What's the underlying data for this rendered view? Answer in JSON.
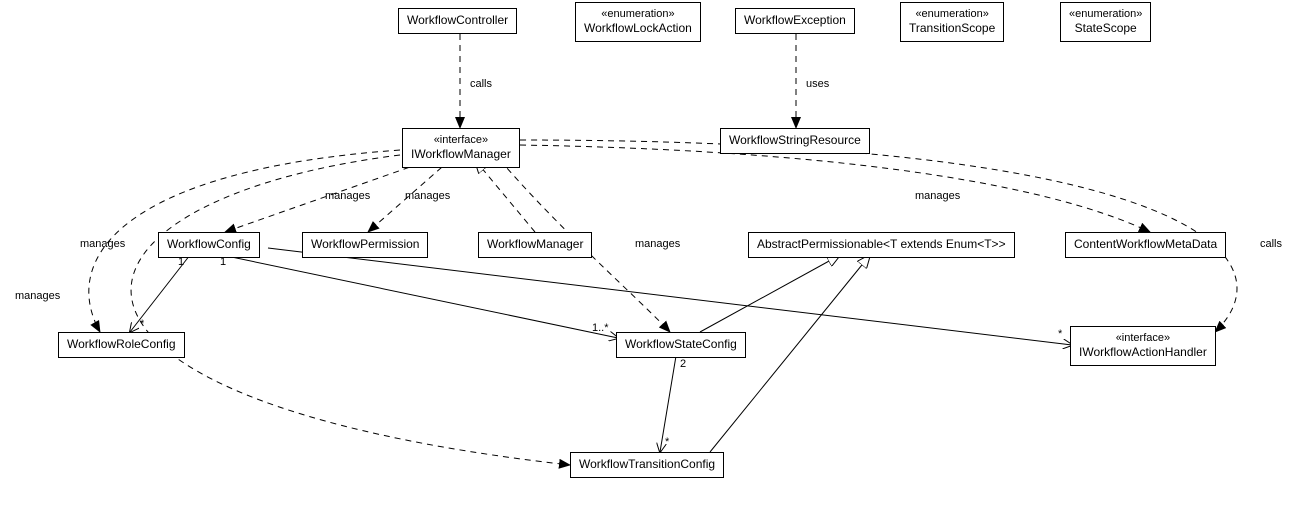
{
  "nodes": {
    "workflowController": {
      "label": "WorkflowController"
    },
    "workflowLockAction": {
      "stereo": "«enumeration»",
      "label": "WorkflowLockAction"
    },
    "workflowException": {
      "label": "WorkflowException"
    },
    "transitionScope": {
      "stereo": "«enumeration»",
      "label": "TransitionScope"
    },
    "stateScope": {
      "stereo": "«enumeration»",
      "label": "StateScope"
    },
    "iWorkflowManager": {
      "stereo": "«interface»",
      "label": "IWorkflowManager"
    },
    "workflowStringResource": {
      "label": "WorkflowStringResource"
    },
    "workflowConfig": {
      "label": "WorkflowConfig"
    },
    "workflowPermission": {
      "label": "WorkflowPermission"
    },
    "workflowManager": {
      "label": "WorkflowManager"
    },
    "abstractPermissionable": {
      "label": "AbstractPermissionable<T extends Enum<T>>"
    },
    "contentWorkflowMetaData": {
      "label": "ContentWorkflowMetaData"
    },
    "workflowRoleConfig": {
      "label": "WorkflowRoleConfig"
    },
    "workflowStateConfig": {
      "label": "WorkflowStateConfig"
    },
    "iWorkflowActionHandler": {
      "stereo": "«interface»",
      "label": "IWorkflowActionHandler"
    },
    "workflowTransitionConfig": {
      "label": "WorkflowTransitionConfig"
    }
  },
  "edgeLabels": {
    "calls1": "calls",
    "uses": "uses",
    "manages1": "manages",
    "manages2": "manages",
    "manages3": "manages",
    "manages4": "manages",
    "manages5": "manages",
    "manages6": "manages",
    "calls2": "calls"
  },
  "mult": {
    "wc1a": "1",
    "wc1b": "1",
    "wrcStar": "*",
    "wscN": "1..*",
    "wsc2": "2",
    "wtcStar": "*",
    "wahStar": "*"
  }
}
